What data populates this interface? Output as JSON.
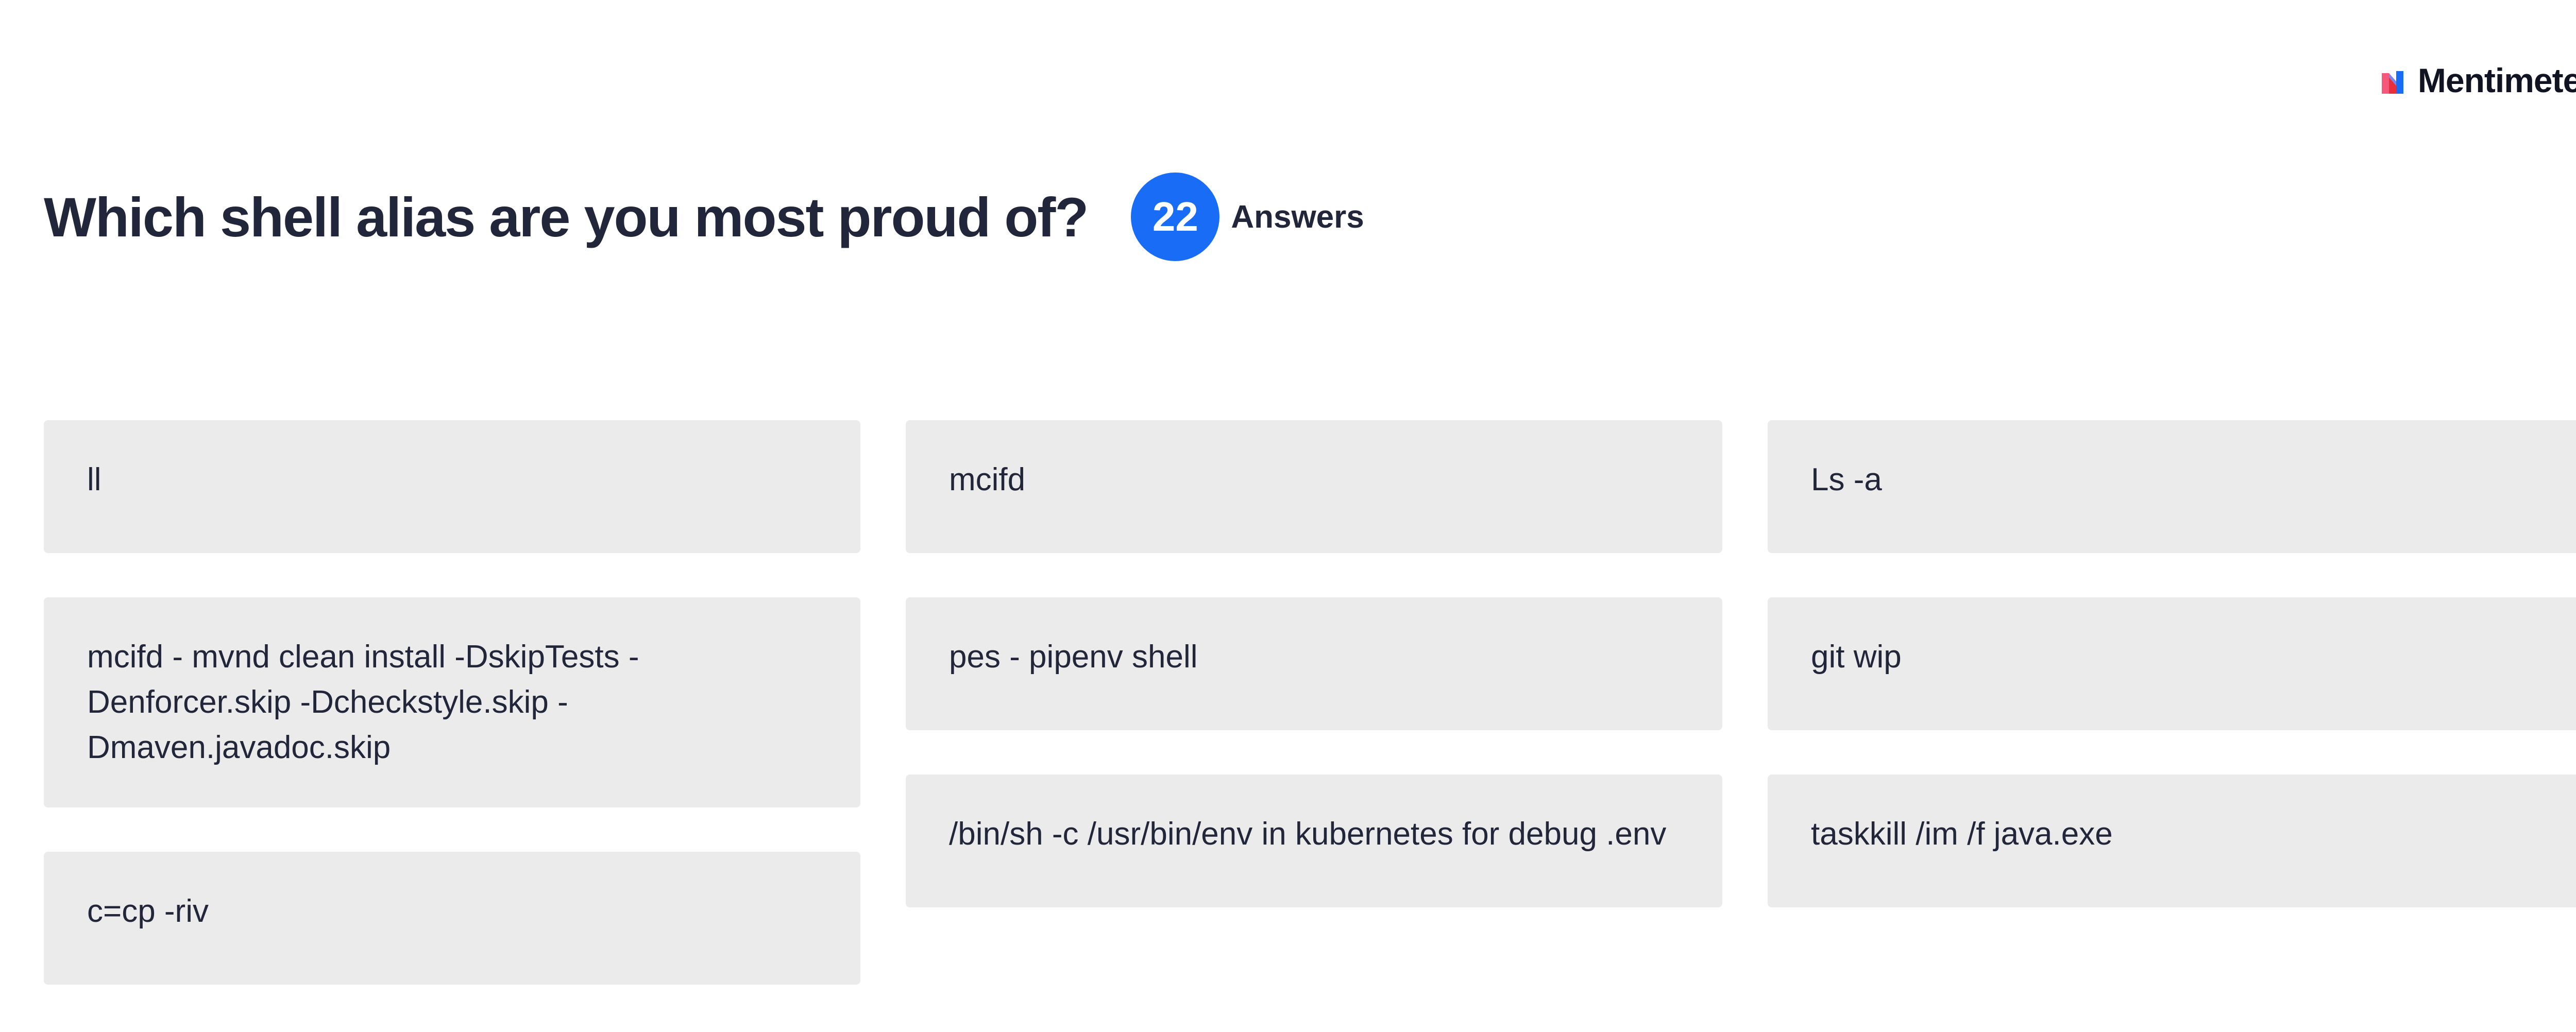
{
  "brand": {
    "name": "Mentimeter",
    "colors": {
      "pink": "#f5587a",
      "blue": "#196cf5",
      "red": "#e8303b"
    }
  },
  "question": {
    "title": "Which shell alias are you most proud of?",
    "count": "22",
    "count_label": "Answers",
    "badge_color": "#196cf5"
  },
  "columns": [
    {
      "answers": [
        "ll",
        "mcifd - mvnd clean install -DskipTests -Denforcer.skip -Dcheckstyle.skip -Dmaven.javadoc.skip",
        "c=cp -riv"
      ]
    },
    {
      "answers": [
        "mcifd",
        "pes - pipenv shell",
        "/bin/sh -c /usr/bin/env in kubernetes for debug .env"
      ]
    },
    {
      "answers": [
        "Ls -a",
        "git wip",
        "taskkill /im /f java.exe"
      ]
    }
  ]
}
